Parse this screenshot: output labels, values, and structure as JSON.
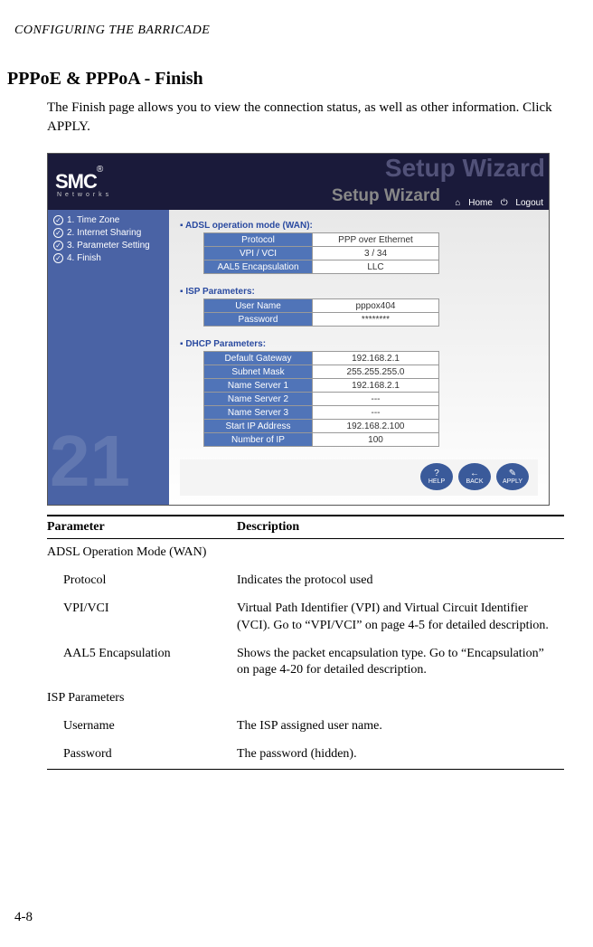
{
  "running_head": "CONFIGURING THE BARRICADE",
  "section_title": "PPPoE & PPPoA - Finish",
  "body_text": "The Finish page allows you to view the connection status, as well as other information. Click APPLY.",
  "page_number": "4-8",
  "screenshot": {
    "logo_text": "SMC",
    "logo_sub": "Networks",
    "watermark_bg": "Setup Wizard",
    "title2": "Setup Wizard",
    "home_link": "Home",
    "logout_link": "Logout",
    "sidebar": {
      "items": [
        {
          "label": "1. Time Zone"
        },
        {
          "label": "2. Internet Sharing"
        },
        {
          "label": "3. Parameter Setting"
        },
        {
          "label": "4. Finish"
        }
      ]
    },
    "sections": {
      "adsl": {
        "heading": "ADSL operation mode (WAN):",
        "rows": [
          {
            "k": "Protocol",
            "v": "PPP over Ethernet"
          },
          {
            "k": "VPI / VCI",
            "v": "3 / 34"
          },
          {
            "k": "AAL5 Encapsulation",
            "v": "LLC"
          }
        ]
      },
      "isp": {
        "heading": "ISP Parameters:",
        "rows": [
          {
            "k": "User Name",
            "v": "pppox404"
          },
          {
            "k": "Password",
            "v": "********"
          }
        ]
      },
      "dhcp": {
        "heading": "DHCP Parameters:",
        "rows": [
          {
            "k": "Default Gateway",
            "v": "192.168.2.1"
          },
          {
            "k": "Subnet Mask",
            "v": "255.255.255.0"
          },
          {
            "k": "Name Server 1",
            "v": "192.168.2.1"
          },
          {
            "k": "Name Server 2",
            "v": "---"
          },
          {
            "k": "Name Server 3",
            "v": "---"
          },
          {
            "k": "Start IP Address",
            "v": "192.168.2.100"
          },
          {
            "k": "Number of IP",
            "v": "100"
          }
        ]
      }
    },
    "buttons": {
      "help": "HELP",
      "back": "BACK",
      "apply": "APPLY"
    }
  },
  "param_table": {
    "headers": {
      "c1": "Parameter",
      "c2": "Description"
    },
    "rows": [
      {
        "c1": "ADSL Operation Mode (WAN)",
        "c2": "",
        "indent": false
      },
      {
        "c1": "Protocol",
        "c2": "Indicates the protocol used",
        "indent": true
      },
      {
        "c1": "VPI/VCI",
        "c2": "Virtual Path Identifier (VPI) and Virtual Circuit Identifier (VCI). Go to “VPI/VCI” on page 4-5 for detailed description.",
        "indent": true
      },
      {
        "c1": "AAL5 Encapsulation",
        "c2": "Shows the packet encapsulation type. Go to “Encapsulation” on page 4-20 for detailed description.",
        "indent": true
      },
      {
        "c1": "ISP Parameters",
        "c2": "",
        "indent": false
      },
      {
        "c1": "Username",
        "c2": "The ISP assigned user name.",
        "indent": true
      },
      {
        "c1": "Password",
        "c2": "The password (hidden).",
        "indent": true
      }
    ]
  }
}
